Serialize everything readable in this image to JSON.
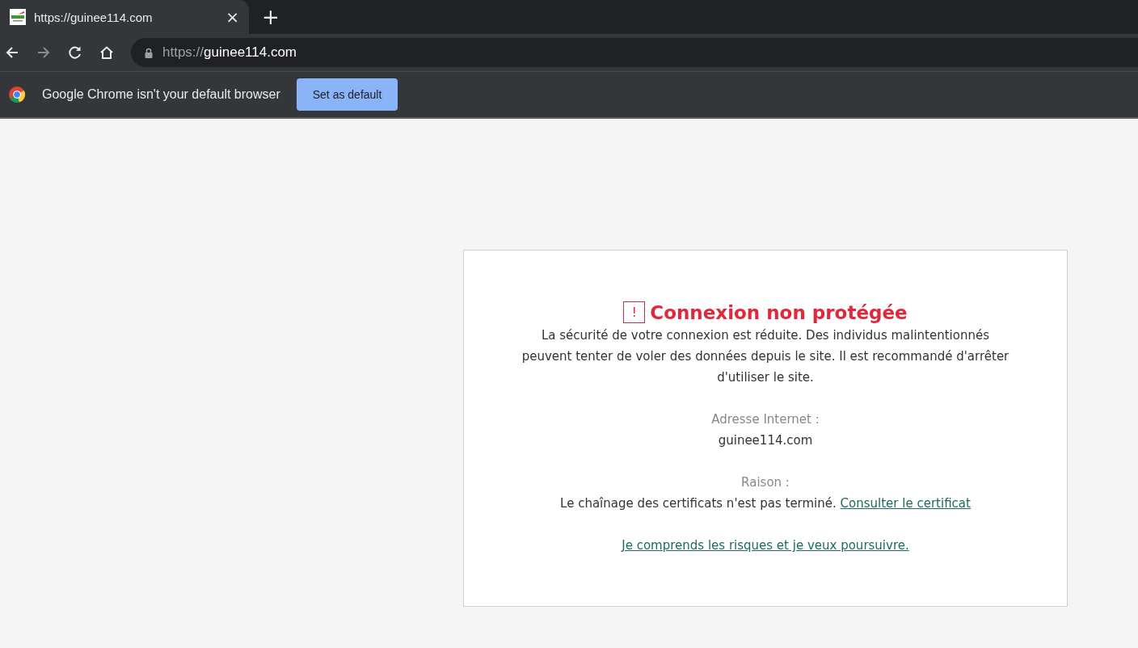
{
  "tab": {
    "title": "https://guinee114.com",
    "close": "×",
    "new_tab": "+",
    "selected": true
  },
  "address_bar": {
    "scheme": "https://",
    "host": "guinee114.com"
  },
  "infobar": {
    "message": "Google Chrome isn't your default browser",
    "button": "Set as default"
  },
  "error_page": {
    "icon": "!",
    "title": "Connexion non protégée",
    "description": "La sécurité de votre connexion est réduite. Des individus malintentionnés peuvent tenter de voler des données depuis le site. Il est recommandé d'arrêter d'utiliser le site.",
    "address_label": "Adresse Internet :",
    "address_value": "guinee114.com",
    "reason_label": "Raison :",
    "reason_text": "Le chaînage des certificats n'est pas terminé.",
    "certificate_link": "Consulter le certificat",
    "proceed_link": "Je comprends les risques et je veux poursuivre."
  }
}
